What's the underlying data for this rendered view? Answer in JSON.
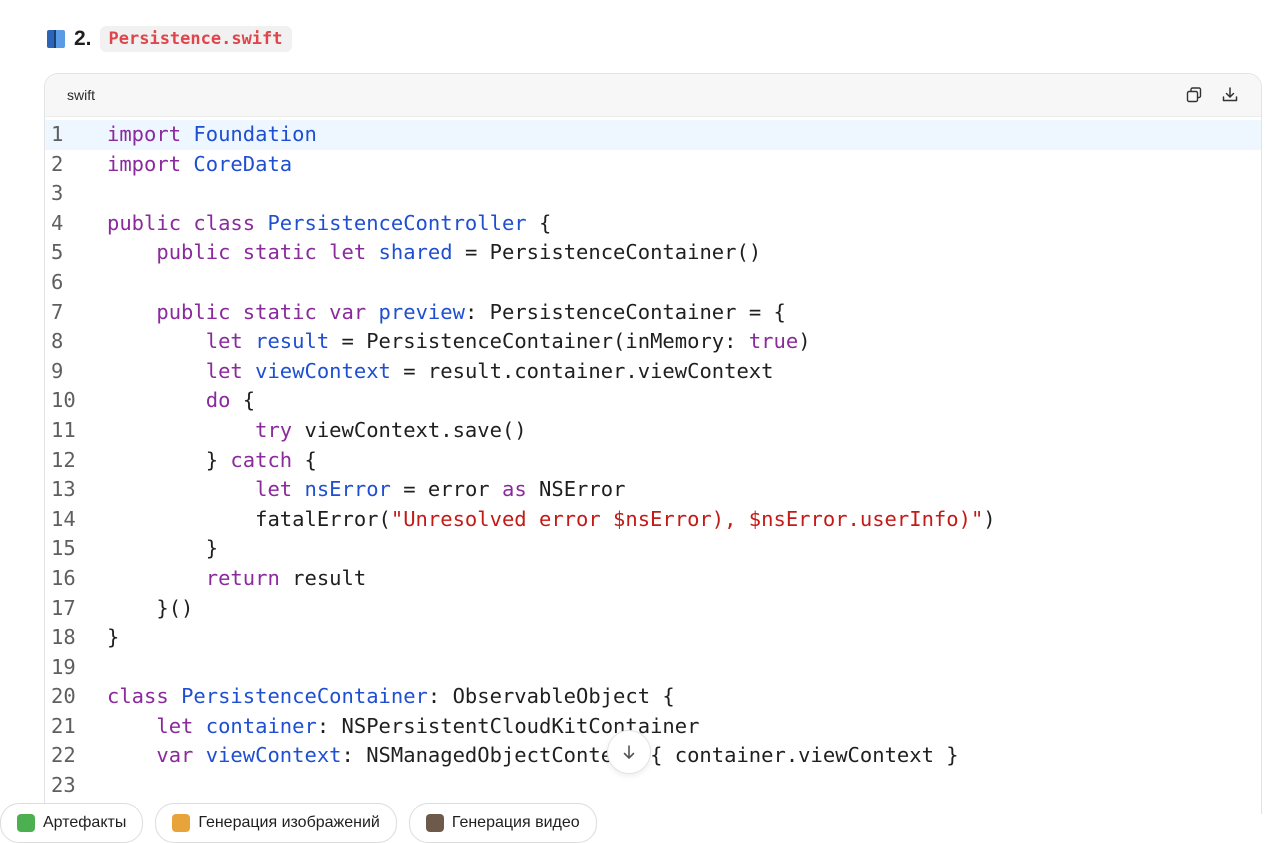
{
  "heading": {
    "number": "2.",
    "filename": "Persistence.swift",
    "icon": "blue-book-icon"
  },
  "code_block": {
    "language": "swift",
    "copy_icon": "copy-icon",
    "download_icon": "download-icon",
    "lines": [
      {
        "n": "1",
        "active": true,
        "tokens": [
          [
            "kw",
            "import"
          ],
          [
            "pl",
            " "
          ],
          [
            "ty",
            "Foundation"
          ]
        ]
      },
      {
        "n": "2",
        "tokens": [
          [
            "kw",
            "import"
          ],
          [
            "pl",
            " "
          ],
          [
            "ty",
            "CoreData"
          ]
        ]
      },
      {
        "n": "3",
        "tokens": []
      },
      {
        "n": "4",
        "tokens": [
          [
            "kw",
            "public class"
          ],
          [
            "pl",
            " "
          ],
          [
            "ty",
            "PersistenceController"
          ],
          [
            "pl",
            " {"
          ]
        ]
      },
      {
        "n": "5",
        "tokens": [
          [
            "pl",
            "    "
          ],
          [
            "kw",
            "public static let"
          ],
          [
            "pl",
            " "
          ],
          [
            "ty",
            "shared"
          ],
          [
            "pl",
            " = PersistenceContainer()"
          ]
        ]
      },
      {
        "n": "6",
        "tokens": []
      },
      {
        "n": "7",
        "tokens": [
          [
            "pl",
            "    "
          ],
          [
            "kw",
            "public static var"
          ],
          [
            "pl",
            " "
          ],
          [
            "ty",
            "preview"
          ],
          [
            "pl",
            ": PersistenceContainer = {"
          ]
        ]
      },
      {
        "n": "8",
        "tokens": [
          [
            "pl",
            "        "
          ],
          [
            "kw",
            "let"
          ],
          [
            "pl",
            " "
          ],
          [
            "ty",
            "result"
          ],
          [
            "pl",
            " = PersistenceContainer(inMemory: "
          ],
          [
            "kw",
            "true"
          ],
          [
            "pl",
            ")"
          ]
        ]
      },
      {
        "n": "9",
        "tokens": [
          [
            "pl",
            "        "
          ],
          [
            "kw",
            "let"
          ],
          [
            "pl",
            " "
          ],
          [
            "ty",
            "viewContext"
          ],
          [
            "pl",
            " = result.container.viewContext"
          ]
        ]
      },
      {
        "n": "10",
        "tokens": [
          [
            "pl",
            "        "
          ],
          [
            "kw",
            "do"
          ],
          [
            "pl",
            " {"
          ]
        ]
      },
      {
        "n": "11",
        "tokens": [
          [
            "pl",
            "            "
          ],
          [
            "kw",
            "try"
          ],
          [
            "pl",
            " viewContext.save()"
          ]
        ]
      },
      {
        "n": "12",
        "tokens": [
          [
            "pl",
            "        } "
          ],
          [
            "kw",
            "catch"
          ],
          [
            "pl",
            " {"
          ]
        ]
      },
      {
        "n": "13",
        "tokens": [
          [
            "pl",
            "            "
          ],
          [
            "kw",
            "let"
          ],
          [
            "pl",
            " "
          ],
          [
            "ty",
            "nsError"
          ],
          [
            "pl",
            " = error "
          ],
          [
            "kw",
            "as"
          ],
          [
            "pl",
            " NSError"
          ]
        ]
      },
      {
        "n": "14",
        "tokens": [
          [
            "pl",
            "            fatalError("
          ],
          [
            "st",
            "\"Unresolved error $nsError), $nsError.userInfo)\""
          ],
          [
            "pl",
            ")"
          ]
        ]
      },
      {
        "n": "15",
        "tokens": [
          [
            "pl",
            "        }"
          ]
        ]
      },
      {
        "n": "16",
        "tokens": [
          [
            "pl",
            "        "
          ],
          [
            "kw",
            "return"
          ],
          [
            "pl",
            " result"
          ]
        ]
      },
      {
        "n": "17",
        "tokens": [
          [
            "pl",
            "    }()"
          ]
        ]
      },
      {
        "n": "18",
        "tokens": [
          [
            "pl",
            "}"
          ]
        ]
      },
      {
        "n": "19",
        "tokens": []
      },
      {
        "n": "20",
        "tokens": [
          [
            "kw",
            "class"
          ],
          [
            "pl",
            " "
          ],
          [
            "ty",
            "PersistenceContainer"
          ],
          [
            "pl",
            ": ObservableObject {"
          ]
        ]
      },
      {
        "n": "21",
        "tokens": [
          [
            "pl",
            "    "
          ],
          [
            "kw",
            "let"
          ],
          [
            "pl",
            " "
          ],
          [
            "ty",
            "container"
          ],
          [
            "pl",
            ": NSPersistentCloudKitContainer"
          ]
        ]
      },
      {
        "n": "22",
        "tokens": [
          [
            "pl",
            "    "
          ],
          [
            "kw",
            "var"
          ],
          [
            "pl",
            " "
          ],
          [
            "ty",
            "viewContext"
          ],
          [
            "pl",
            ": NSManagedObjectContext { container.viewContext }"
          ]
        ]
      },
      {
        "n": "23",
        "tokens": []
      }
    ]
  },
  "scroll_button": {
    "icon": "arrow-down-icon"
  },
  "chips": [
    {
      "label": "Артефакты",
      "icon": "puzzle-icon",
      "color": "#4caf50"
    },
    {
      "label": "Генерация изображений",
      "icon": "palette-icon",
      "color": "#e8a33a"
    },
    {
      "label": "Генерация видео",
      "icon": "film-icon",
      "color": "#6d5a4a"
    }
  ]
}
